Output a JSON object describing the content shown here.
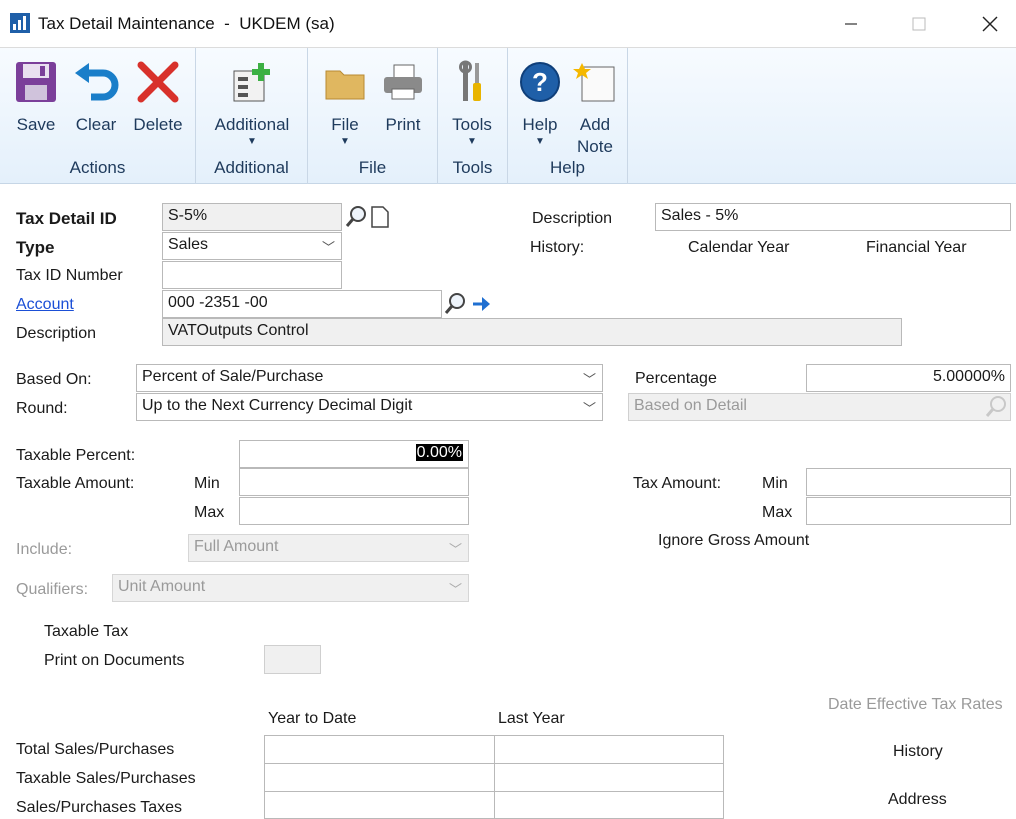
{
  "window": {
    "app": "Tax Detail Maintenance",
    "company": "UKDEM (sa)"
  },
  "ribbon": {
    "groups": [
      {
        "label": "Actions",
        "buttons": [
          "Save",
          "Clear",
          "Delete"
        ]
      },
      {
        "label": "Additional",
        "buttons": [
          "Additional"
        ]
      },
      {
        "label": "File",
        "buttons": [
          "File",
          "Print"
        ]
      },
      {
        "label": "Tools",
        "buttons": [
          "Tools"
        ]
      },
      {
        "label": "Help",
        "buttons": [
          "Help",
          "Add\nNote"
        ]
      }
    ],
    "save": "Save",
    "clear": "Clear",
    "delete": "Delete",
    "additional": "Additional",
    "file": "File",
    "print": "Print",
    "tools": "Tools",
    "help": "Help",
    "add_note_1": "Add",
    "add_note_2": "Note",
    "grp_actions": "Actions",
    "grp_additional": "Additional",
    "grp_file": "File",
    "grp_tools": "Tools",
    "grp_help": "Help"
  },
  "form": {
    "tax_detail_id_label": "Tax Detail ID",
    "tax_detail_id": "S-5%",
    "type_label": "Type",
    "type_value": "Sales",
    "tax_id_number_label": "Tax ID Number",
    "tax_id_number": "",
    "account_label": "Account",
    "account_value": "000 -2351 -00",
    "description_label": "Description",
    "account_description": "VATOutputs Control",
    "description_right_label": "Description",
    "description_right": "Sales - 5%",
    "history_label": "History:",
    "calendar_year": "Calendar Year",
    "financial_year": "Financial Year",
    "based_on_label": "Based On:",
    "based_on_value": "Percent of Sale/Purchase",
    "round_label": "Round:",
    "round_value": "Up to the Next Currency Decimal Digit",
    "percentage_label": "Percentage",
    "percentage_value": "5.00000%",
    "based_on_detail_label": "Based on Detail",
    "taxable_percent_label": "Taxable Percent:",
    "taxable_percent_value": "0.00%",
    "taxable_amount_label": "Taxable Amount:",
    "min_label": "Min",
    "max_label": "Max",
    "tax_amount_label": "Tax Amount:",
    "tax_min_label": "Min",
    "tax_max_label": "Max",
    "ignore_gross_label": "Ignore Gross Amount",
    "include_label": "Include:",
    "include_value": "Full Amount",
    "qualifiers_label": "Qualifiers:",
    "qualifiers_value": "Unit Amount",
    "taxable_tax_label": "Taxable Tax",
    "print_docs_label": "Print on Documents",
    "date_effective_label": "Date Effective Tax Rates",
    "ytd_label": "Year to Date",
    "last_year_label": "Last Year",
    "rows": [
      "Total Sales/Purchases",
      "Taxable Sales/Purchases",
      "Sales/Purchases Taxes"
    ],
    "history_button": "History",
    "address_button": "Address"
  },
  "colors": {
    "accent": "#1f5fa8",
    "ribbon_bg": "#e4f0fb",
    "link": "#1b4fd6"
  }
}
